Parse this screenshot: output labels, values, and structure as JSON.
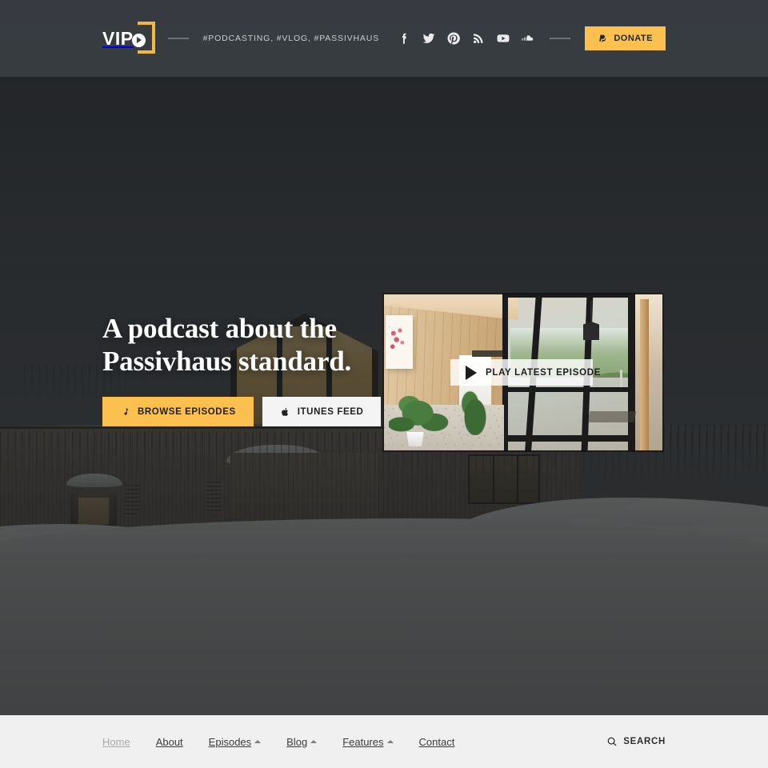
{
  "header": {
    "logo": {
      "text": "VIP",
      "icon": "play-circle-icon"
    },
    "tagline": "#PODCASTING, #VLOG, #PASSIVHAUS",
    "socials": [
      {
        "name": "facebook-icon",
        "label": "Facebook"
      },
      {
        "name": "twitter-icon",
        "label": "Twitter"
      },
      {
        "name": "pinterest-icon",
        "label": "Pinterest"
      },
      {
        "name": "rss-icon",
        "label": "RSS"
      },
      {
        "name": "youtube-icon",
        "label": "YouTube"
      },
      {
        "name": "soundcloud-icon",
        "label": "SoundCloud"
      }
    ],
    "donate_label": "DONATE",
    "donate_icon": "paypal-icon"
  },
  "hero": {
    "headline_line1": "A podcast about the",
    "headline_line2": "Passivhaus standard.",
    "buttons": [
      {
        "label": "BROWSE EPISODES",
        "icon": "music-note-icon",
        "style": "primary"
      },
      {
        "label": "ITUNES FEED",
        "icon": "apple-icon",
        "style": "light"
      }
    ],
    "video": {
      "play_label": "PLAY LATEST EPISODE",
      "play_icon": "play-triangle-icon"
    }
  },
  "bottom_nav": {
    "items": [
      {
        "label": "Home",
        "has_dropdown": false,
        "active": true
      },
      {
        "label": "About",
        "has_dropdown": false,
        "active": false
      },
      {
        "label": "Episodes",
        "has_dropdown": true,
        "active": false
      },
      {
        "label": "Blog",
        "has_dropdown": true,
        "active": false
      },
      {
        "label": "Features",
        "has_dropdown": true,
        "active": false
      },
      {
        "label": "Contact",
        "has_dropdown": false,
        "active": false
      }
    ],
    "search_label": "SEARCH",
    "search_icon": "search-icon"
  },
  "colors": {
    "accent": "#fbc04e",
    "header_bg": "#3a3e43",
    "nav_bg": "#f0f0f0",
    "text_light": "#ffffff",
    "nav_text": "#3b3b3b",
    "nav_text_muted": "#a9a9a9"
  }
}
